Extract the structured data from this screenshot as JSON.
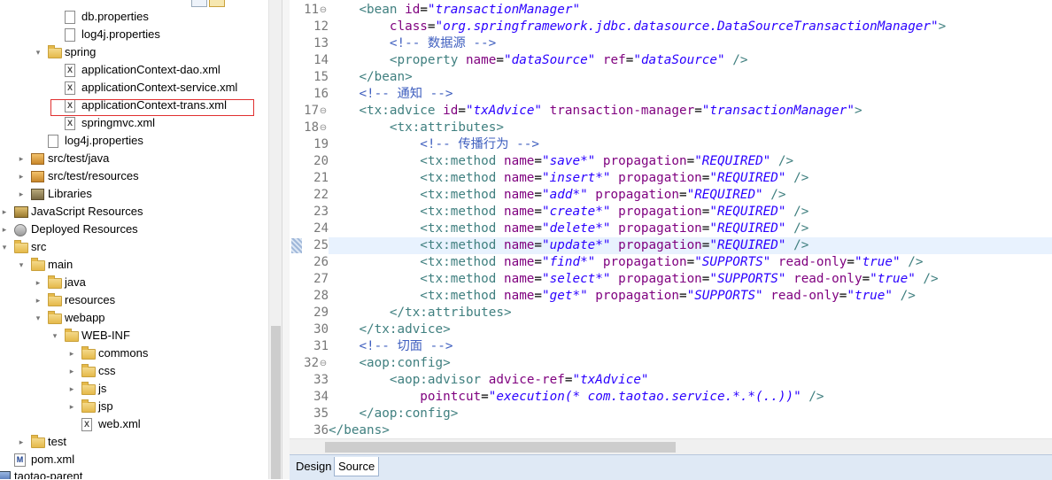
{
  "explorer": {
    "items": [
      {
        "label": "db.properties",
        "icon": "file-icon"
      },
      {
        "label": "log4j.properties",
        "icon": "file-icon"
      },
      {
        "label": "spring",
        "icon": "folder-icon",
        "expanded": true
      },
      {
        "label": "applicationContext-dao.xml",
        "icon": "xml-file-icon"
      },
      {
        "label": "applicationContext-service.xml",
        "icon": "xml-file-icon"
      },
      {
        "label": "applicationContext-trans.xml",
        "icon": "xml-file-icon",
        "highlighted": true
      },
      {
        "label": "springmvc.xml",
        "icon": "xml-file-icon"
      },
      {
        "label": "log4j.properties",
        "icon": "file-icon"
      },
      {
        "label": "src/test/java",
        "icon": "source-folder-icon"
      },
      {
        "label": "src/test/resources",
        "icon": "source-folder-icon"
      },
      {
        "label": "Libraries",
        "icon": "library-icon"
      },
      {
        "label": "JavaScript Resources",
        "icon": "javascript-resources-icon"
      },
      {
        "label": "Deployed Resources",
        "icon": "deployed-resources-icon"
      },
      {
        "label": "src",
        "icon": "folder-icon",
        "expanded": true
      },
      {
        "label": "main",
        "icon": "folder-icon",
        "expanded": true
      },
      {
        "label": "java",
        "icon": "folder-icon"
      },
      {
        "label": "resources",
        "icon": "folder-icon"
      },
      {
        "label": "webapp",
        "icon": "folder-icon",
        "expanded": true
      },
      {
        "label": "WEB-INF",
        "icon": "folder-icon",
        "expanded": true
      },
      {
        "label": "commons",
        "icon": "folder-icon"
      },
      {
        "label": "css",
        "icon": "folder-icon"
      },
      {
        "label": "js",
        "icon": "folder-icon"
      },
      {
        "label": "jsp",
        "icon": "folder-icon"
      },
      {
        "label": "web.xml",
        "icon": "xml-file-icon"
      },
      {
        "label": "test",
        "icon": "folder-icon"
      },
      {
        "label": "pom.xml",
        "icon": "maven-pom-icon"
      },
      {
        "label": "taotao-parent",
        "icon": "project-icon"
      }
    ]
  },
  "editor": {
    "current_line": "25",
    "lines": [
      {
        "n": "11",
        "text": "    <bean id=\"transactionManager\""
      },
      {
        "n": "12",
        "text": "        class=\"org.springframework.jdbc.datasource.DataSourceTransactionManager\">"
      },
      {
        "n": "13",
        "text": "        <!-- 数据源 -->"
      },
      {
        "n": "14",
        "text": "        <property name=\"dataSource\" ref=\"dataSource\" />"
      },
      {
        "n": "15",
        "text": "    </bean>"
      },
      {
        "n": "16",
        "text": "    <!-- 通知 -->"
      },
      {
        "n": "17",
        "text": "    <tx:advice id=\"txAdvice\" transaction-manager=\"transactionManager\">"
      },
      {
        "n": "18",
        "text": "        <tx:attributes>"
      },
      {
        "n": "19",
        "text": "            <!-- 传播行为 -->"
      },
      {
        "n": "20",
        "text": "            <tx:method name=\"save*\" propagation=\"REQUIRED\" />"
      },
      {
        "n": "21",
        "text": "            <tx:method name=\"insert*\" propagation=\"REQUIRED\" />"
      },
      {
        "n": "22",
        "text": "            <tx:method name=\"add*\" propagation=\"REQUIRED\" />"
      },
      {
        "n": "23",
        "text": "            <tx:method name=\"create*\" propagation=\"REQUIRED\" />"
      },
      {
        "n": "24",
        "text": "            <tx:method name=\"delete*\" propagation=\"REQUIRED\" />"
      },
      {
        "n": "25",
        "text": "            <tx:method name=\"update*\" propagation=\"REQUIRED\" />"
      },
      {
        "n": "26",
        "text": "            <tx:method name=\"find*\" propagation=\"SUPPORTS\" read-only=\"true\" />"
      },
      {
        "n": "27",
        "text": "            <tx:method name=\"select*\" propagation=\"SUPPORTS\" read-only=\"true\" />"
      },
      {
        "n": "28",
        "text": "            <tx:method name=\"get*\" propagation=\"SUPPORTS\" read-only=\"true\" />"
      },
      {
        "n": "29",
        "text": "        </tx:attributes>"
      },
      {
        "n": "30",
        "text": "    </tx:advice>"
      },
      {
        "n": "31",
        "text": "    <!-- 切面 -->"
      },
      {
        "n": "32",
        "text": "    <aop:config>"
      },
      {
        "n": "33",
        "text": "        <aop:advisor advice-ref=\"txAdvice\""
      },
      {
        "n": "34",
        "text": "            pointcut=\"execution(* com.taotao.service.*.*(..))\" />"
      },
      {
        "n": "35",
        "text": "    </aop:config>"
      },
      {
        "n": "36",
        "text": "</beans>"
      }
    ]
  },
  "tabs": {
    "design": "Design",
    "source": "Source",
    "active": "Source"
  },
  "colors": {
    "tag": "#3f7f7f",
    "attribute": "#7f007f",
    "value": "#2a00ff",
    "comment": "#3f5fbf",
    "current_line": "#e8f2fe",
    "highlight_box": "#e03030"
  }
}
